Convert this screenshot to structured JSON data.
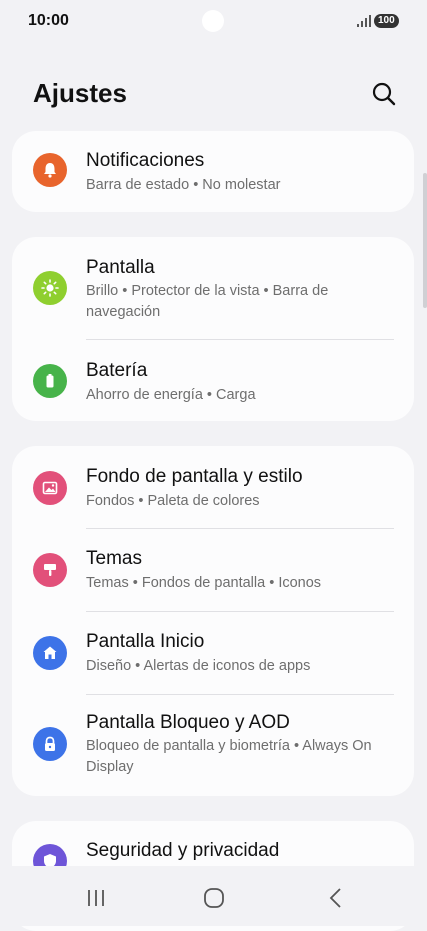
{
  "status": {
    "time": "10:00",
    "battery": "100"
  },
  "header": {
    "title": "Ajustes"
  },
  "cards": [
    {
      "items": [
        {
          "title": "Notificaciones",
          "subtitle": "Barra de estado  •  No molestar",
          "icon": "bell-icon",
          "color": "#e8642c"
        }
      ]
    },
    {
      "items": [
        {
          "title": "Pantalla",
          "subtitle": "Brillo  •  Protector de la vista  •  Barra de navegación",
          "icon": "brightness-icon",
          "color": "#8fcf2f"
        },
        {
          "title": "Batería",
          "subtitle": "Ahorro de energía  •  Carga",
          "icon": "battery-icon",
          "color": "#47b34a"
        }
      ]
    },
    {
      "items": [
        {
          "title": "Fondo de pantalla y estilo",
          "subtitle": "Fondos  •  Paleta de colores",
          "icon": "wallpaper-icon",
          "color": "#e2507a"
        },
        {
          "title": "Temas",
          "subtitle": "Temas  •  Fondos de pantalla  •  Iconos",
          "icon": "themes-brush-icon",
          "color": "#e2507a"
        },
        {
          "title": "Pantalla Inicio",
          "subtitle": "Diseño  •  Alertas de iconos de apps",
          "icon": "home-icon",
          "color": "#3d73e8"
        },
        {
          "title": "Pantalla Bloqueo y AOD",
          "subtitle": "Bloqueo de pantalla y biometría  •  Always On Display",
          "icon": "lock-icon",
          "color": "#3d73e8"
        }
      ]
    },
    {
      "items": [
        {
          "title": "Seguridad y privacidad",
          "subtitle": "",
          "icon": "shield-icon",
          "color": "#6e55d8"
        }
      ]
    }
  ]
}
